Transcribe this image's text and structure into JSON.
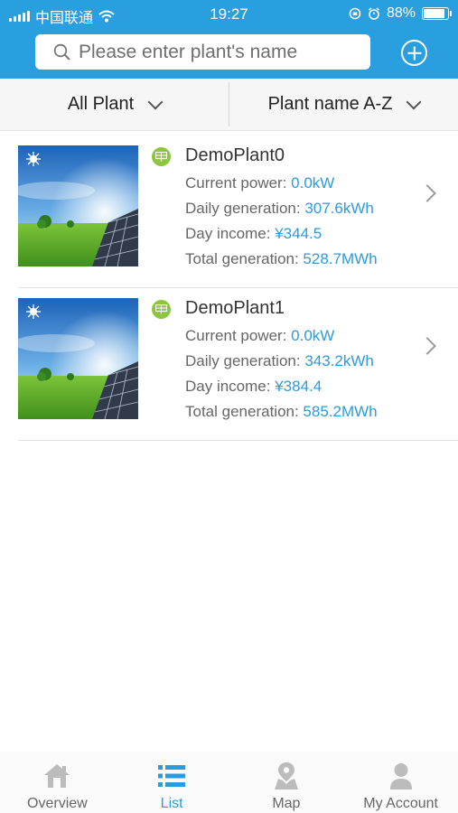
{
  "status_bar": {
    "carrier": "中国联通",
    "time": "19:27",
    "battery_text": "88%",
    "battery_level": 0.88
  },
  "search": {
    "placeholder": "Please enter plant's name",
    "icons": [
      "search-icon",
      "plus-circle-icon"
    ]
  },
  "filters": {
    "plant_filter": "All Plant",
    "sort": "Plant name A-Z"
  },
  "plants": [
    {
      "name": "DemoPlant0",
      "current_power_label": "Current power: ",
      "current_power": "0.0kW",
      "daily_generation_label": "Daily generation: ",
      "daily_generation": "307.6kWh",
      "day_income_label": "Day income: ",
      "day_income": "¥344.5",
      "total_generation_label": "Total generation: ",
      "total_generation": "528.7MWh"
    },
    {
      "name": "DemoPlant1",
      "current_power_label": "Current power: ",
      "current_power": "0.0kW",
      "daily_generation_label": "Daily generation: ",
      "daily_generation": "343.2kWh",
      "day_income_label": "Day income: ",
      "day_income": "¥384.4",
      "total_generation_label": "Total generation: ",
      "total_generation": "585.2MWh"
    }
  ],
  "tabs": [
    {
      "label": "Overview",
      "icon": "home-icon",
      "active": false
    },
    {
      "label": "List",
      "icon": "list-icon",
      "active": true
    },
    {
      "label": "Map",
      "icon": "map-icon",
      "active": false
    },
    {
      "label": "My Account",
      "icon": "user-icon",
      "active": false
    }
  ],
  "colors": {
    "header": "#2a9fe0",
    "accent": "#2b9be0",
    "plant_icon": "#8cc63f"
  }
}
